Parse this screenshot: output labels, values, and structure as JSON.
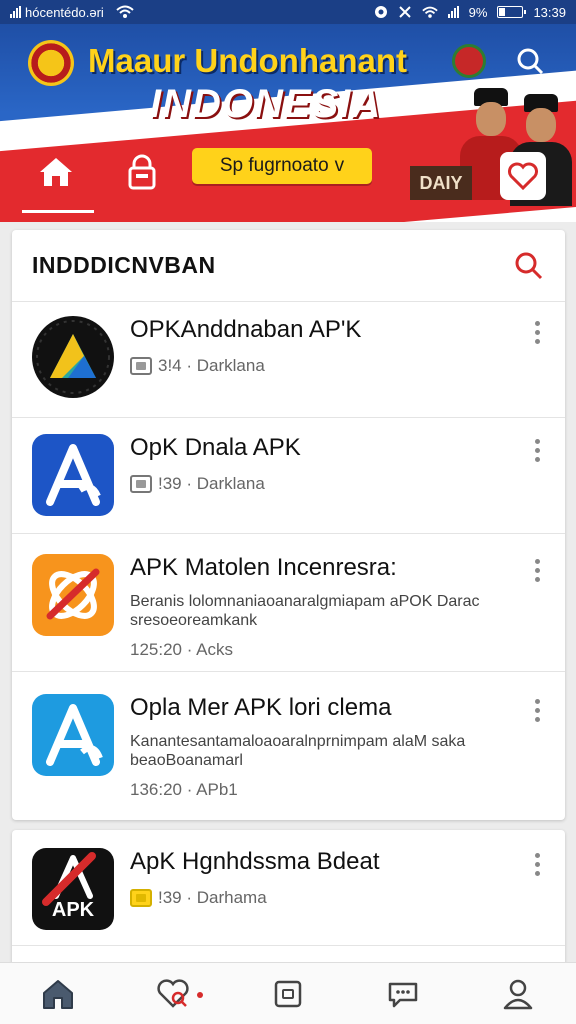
{
  "status_bar": {
    "carrier": "hócentédo.əri",
    "battery_percent": "9%",
    "time": "13:39"
  },
  "banner": {
    "title": "Maaur Undonhanant",
    "subtitle": "INDONESIA",
    "dropdown_label": "Sp fugrnoato",
    "dropdown_caret": "v",
    "board_text": "DAIY",
    "colors": {
      "blue": "#1f4fa6",
      "red": "#e8292e",
      "yellow": "#ffd21a"
    }
  },
  "list": {
    "header": "INDDDICNVBAN",
    "items": [
      {
        "title": "OPKAnddnaban AP'K",
        "meta": "3!4 · Darklana",
        "icon": "apk-triangle-dark-icon"
      },
      {
        "title": "OpK Dnala APK",
        "meta": "!39 · Darklana",
        "icon": "apk-store-blue-icon"
      },
      {
        "title": "APK Matolen Incenresra:",
        "desc": "Beranis lolomnaniaoanaralgmiapam aPOK Darac sresoeoreamkank",
        "time": "125:20 · Acks",
        "icon": "apk-orange-x-icon"
      },
      {
        "title": "Opla Mer APK lori clema",
        "desc": "Kanantesantamaloaoaralnprnimpam alaM saka beaoBoanamarl",
        "time": "136:20 · APb1",
        "icon": "apk-store-lightblue-icon"
      }
    ],
    "second_card_item": {
      "title": "ApK Hgnhdssma Bdeat",
      "meta": "!39 · Darhama",
      "icon_text": "APK",
      "icon": "apk-black-red-icon"
    }
  },
  "bottom_nav": [
    "home-icon",
    "favorites-icon",
    "saved-icon",
    "chat-icon",
    "profile-icon"
  ]
}
